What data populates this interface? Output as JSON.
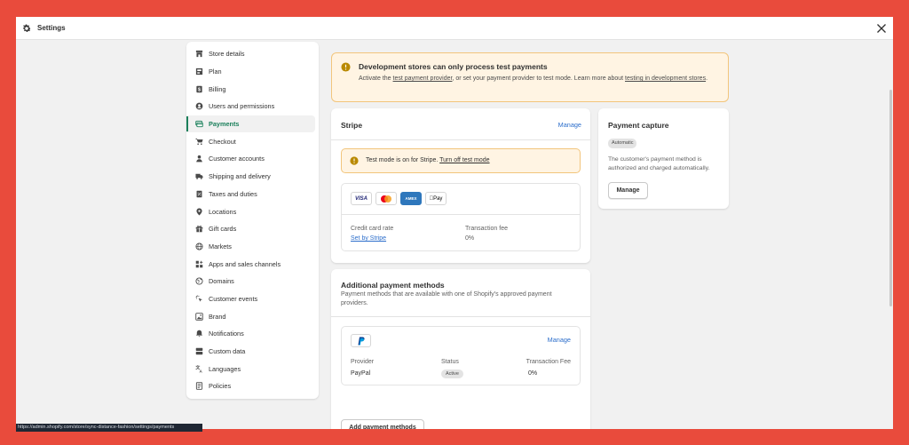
{
  "window": {
    "title": "Settings"
  },
  "sidebar": {
    "active_color": "#1a7f5a",
    "items": [
      {
        "label": "Store details",
        "icon": "store-icon"
      },
      {
        "label": "Plan",
        "icon": "plan-icon"
      },
      {
        "label": "Billing",
        "icon": "billing-icon"
      },
      {
        "label": "Users and permissions",
        "icon": "user-circle-icon"
      },
      {
        "label": "Payments",
        "icon": "payments-icon",
        "active": true
      },
      {
        "label": "Checkout",
        "icon": "cart-icon"
      },
      {
        "label": "Customer accounts",
        "icon": "person-icon"
      },
      {
        "label": "Shipping and delivery",
        "icon": "truck-icon"
      },
      {
        "label": "Taxes and duties",
        "icon": "receipt-icon"
      },
      {
        "label": "Locations",
        "icon": "location-pin-icon"
      },
      {
        "label": "Gift cards",
        "icon": "gift-icon"
      },
      {
        "label": "Markets",
        "icon": "globe-icon"
      },
      {
        "label": "Apps and sales channels",
        "icon": "apps-icon"
      },
      {
        "label": "Domains",
        "icon": "domain-globe-icon"
      },
      {
        "label": "Customer events",
        "icon": "cursor-click-icon"
      },
      {
        "label": "Brand",
        "icon": "brand-icon"
      },
      {
        "label": "Notifications",
        "icon": "bell-icon"
      },
      {
        "label": "Custom data",
        "icon": "database-icon"
      },
      {
        "label": "Languages",
        "icon": "translate-icon"
      },
      {
        "label": "Policies",
        "icon": "policy-icon"
      }
    ]
  },
  "banner": {
    "title": "Development stores can only process test payments",
    "text_1": "Activate the ",
    "link_1": "test payment provider",
    "text_2": ", or set your payment provider to test mode. Learn more about ",
    "link_2": "testing in development stores",
    "text_3": "."
  },
  "stripe": {
    "title": "Stripe",
    "manage": "Manage",
    "testmode_text": "Test mode is on for Stripe. ",
    "testmode_link": "Turn off test mode",
    "logos": [
      "VISA",
      "Mastercard",
      "AMERICAN EXPRESS",
      "Pay"
    ],
    "rate_label": "Credit card rate",
    "rate_value": "Set by Stripe",
    "fee_label": "Transaction fee",
    "fee_value": "0%"
  },
  "capture": {
    "title": "Payment capture",
    "badge": "Automatic",
    "description": "The customer's payment method is authorized and charged automatically.",
    "button": "Manage"
  },
  "additional": {
    "title": "Additional payment methods",
    "description": "Payment methods that are available with one of Shopify's approved payment providers.",
    "provider": {
      "manage": "Manage",
      "provider_label": "Provider",
      "status_label": "Status",
      "fee_label": "Transaction Fee",
      "provider_value": "PayPal",
      "status_value": "Active",
      "fee_value": "0%"
    },
    "button": "Add payment methods"
  },
  "statusbar": {
    "url": "https://admin.shopify.com/store/sync-distance-fashion/settings/payments"
  }
}
